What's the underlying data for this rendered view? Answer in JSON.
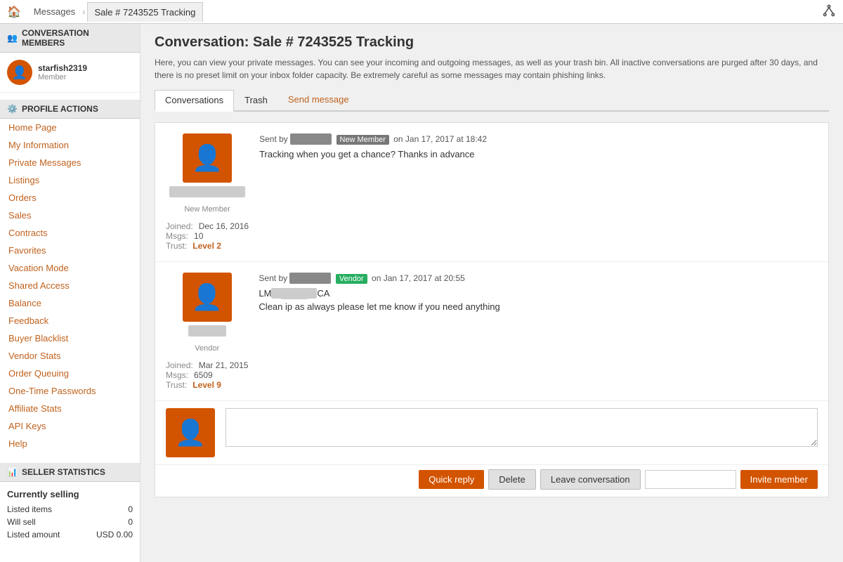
{
  "topNav": {
    "homeIcon": "🏠",
    "links": [
      {
        "label": "Messages",
        "active": false
      },
      {
        "label": "Sale # 7243525 Tracking",
        "active": true
      }
    ],
    "rightIcon": "network"
  },
  "sidebar": {
    "conversationMembers": {
      "heading": "CONVERSATION MEMBERS",
      "user": {
        "name": "starfish2319",
        "role": "Member"
      }
    },
    "profileActions": {
      "heading": "PROFILE ACTIONS",
      "items": [
        "Home Page",
        "My Information",
        "Private Messages",
        "Listings",
        "Orders",
        "Sales",
        "Contracts",
        "Favorites",
        "Vacation Mode",
        "Shared Access",
        "Balance",
        "Feedback",
        "Buyer Blacklist",
        "Vendor Stats",
        "Order Queuing",
        "One-Time Passwords",
        "Affiliate Stats",
        "API Keys",
        "Help"
      ]
    },
    "sellerStats": {
      "heading": "SELLER STATISTICS",
      "currentlySelling": "Currently selling",
      "rows": [
        {
          "label": "Listed items",
          "value": "0"
        },
        {
          "label": "Will sell",
          "value": "0"
        },
        {
          "label": "Listed amount",
          "value": "USD 0.00"
        }
      ]
    }
  },
  "main": {
    "title": "Conversation: Sale # 7243525 Tracking",
    "infoText": "Here, you can view your private messages. You can see your incoming and outgoing messages, as well as your trash bin. All inactive conversations are purged after 30 days, and there is no preset limit on your inbox folder capacity. Be extremely careful as some messages may contain phishing links.",
    "tabs": [
      {
        "label": "Conversations",
        "active": true
      },
      {
        "label": "Trash",
        "active": false
      },
      {
        "label": "Send message",
        "active": false,
        "colored": true
      }
    ],
    "messages": [
      {
        "id": 1,
        "sentBy": "Sent by",
        "userBlur": "██████",
        "badge": "New Member",
        "badgeType": "new-member",
        "dateStr": "on Jan 17, 2017 at 18:42",
        "nameBlur": "████████",
        "role": "New Member",
        "text": "Tracking when you get a chance? Thanks in advance",
        "joined": "Dec 16, 2016",
        "msgs": "10",
        "trustLabel": "Trust:",
        "trust": "Level 2"
      },
      {
        "id": 2,
        "sentBy": "Sent by",
        "userBlur": "██████",
        "badge": "Vendor",
        "badgeType": "vendor",
        "dateStr": "on Jan 17, 2017 at 20:55",
        "nameBlur": "████",
        "role": "Vendor",
        "extraText": "LM██████CA",
        "text": "Clean ip as always please let me know if you need anything",
        "joined": "Mar 21, 2015",
        "msgs": "6509",
        "trustLabel": "Trust:",
        "trust": "Level 9"
      }
    ],
    "replyArea": {
      "placeholder": ""
    },
    "actions": {
      "quickReply": "Quick reply",
      "delete": "Delete",
      "leaveConversation": "Leave conversation",
      "invitePlaceholder": "",
      "inviteMember": "Invite member"
    }
  }
}
